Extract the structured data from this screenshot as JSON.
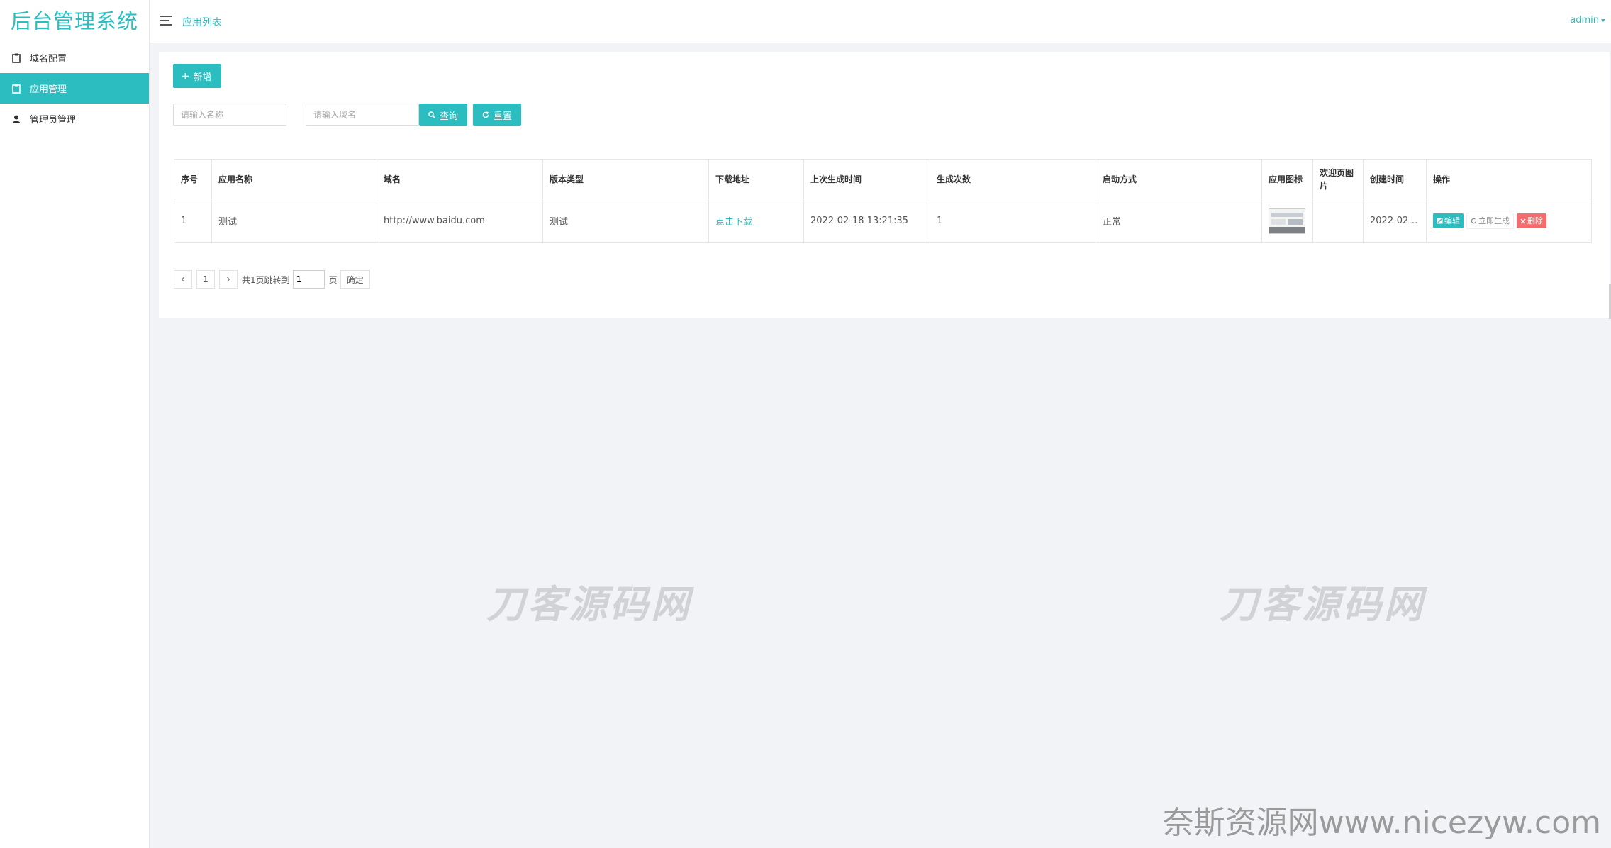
{
  "app": {
    "title": "后台管理系统"
  },
  "sidebar": {
    "items": [
      {
        "label": "域名配置",
        "icon": "clipboard-icon",
        "active": false
      },
      {
        "label": "应用管理",
        "icon": "clipboard-icon",
        "active": true
      },
      {
        "label": "管理员管理",
        "icon": "user-icon",
        "active": false
      }
    ]
  },
  "header": {
    "breadcrumb": "应用列表",
    "user": "admin"
  },
  "toolbar": {
    "add_label": "新增",
    "search": {
      "name_placeholder": "请输入名称",
      "domain_placeholder": "请输入域名",
      "query_label": "查询",
      "reset_label": "重置"
    }
  },
  "table": {
    "columns": [
      "序号",
      "应用名称",
      "域名",
      "版本类型",
      "下载地址",
      "上次生成时间",
      "生成次数",
      "启动方式",
      "应用图标",
      "欢迎页图片",
      "创建时间",
      "操作"
    ],
    "rows": [
      {
        "index": "1",
        "name": "测试",
        "domain": "http://www.baidu.com",
        "version_type": "测试",
        "download": "点击下载",
        "last_generated": "2022-02-18 13:21:35",
        "generate_count": "1",
        "launch_mode": "正常",
        "welcome_image": "",
        "created": "2022-02-...",
        "actions": {
          "edit": "编辑",
          "generate": "立即生成",
          "delete": "删除"
        }
      }
    ]
  },
  "pagination": {
    "current_page": "1",
    "summary": "共1页跳转到",
    "input_value": "1",
    "page_unit": "页",
    "confirm": "确定"
  },
  "watermarks": {
    "center": "刀客源码网",
    "bottom": "奈斯资源网www.nicezyw.com"
  },
  "colors": {
    "accent": "#2bbdbf",
    "danger": "#f56c6c",
    "background": "#f2f3f7"
  }
}
